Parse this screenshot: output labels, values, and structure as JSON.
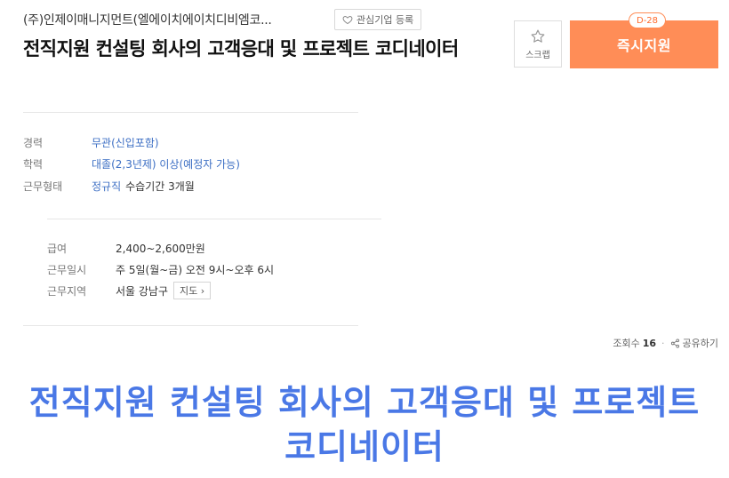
{
  "header": {
    "company": "(주)인제이매니지먼트(엘에이치에이치디비엠코...",
    "fav_label": "관심기업 등록",
    "job_title": "전직지원 컨설팅 회사의 고객응대 및 프로젝트 코디네이터"
  },
  "actions": {
    "scrap_label": "스크랩",
    "apply_label": "즉시지원",
    "dday": "D-28"
  },
  "summary": {
    "career_label": "경력",
    "career_value": "무관(신입포함)",
    "education_label": "학력",
    "education_value": "대졸(2,3년제) 이상(예정자 가능)",
    "employment_label": "근무형태",
    "employment_value": "정규직",
    "employment_extra": "수습기간 3개월"
  },
  "conditions": {
    "salary_label": "급여",
    "salary_value": "2,400~2,600만원",
    "schedule_label": "근무일시",
    "schedule_value": "주 5일(월~금) 오전 9시~오후 6시",
    "location_label": "근무지역",
    "location_value": "서울 강남구",
    "map_label": "지도 ›"
  },
  "meta": {
    "views_label": "조회수",
    "views_count": "16",
    "share_label": "공유하기"
  },
  "caption": {
    "text": "전직지원 컨설팅 회사의 고객응대 및 프로젝트 코디네이터"
  },
  "colors": {
    "accent": "#ff8d57",
    "link": "#3d6fc4",
    "caption": "#4a78e6"
  }
}
